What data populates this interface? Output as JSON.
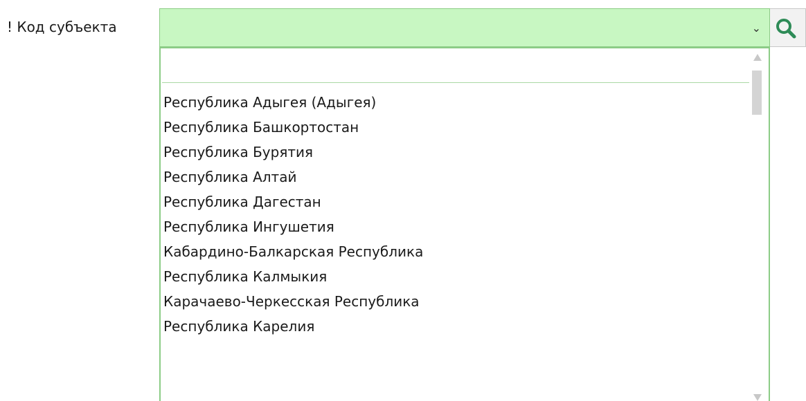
{
  "field": {
    "label": "! Код субъекта",
    "selected_value": "",
    "arrow": "chevron-down-icon"
  },
  "search_button": {
    "icon": "search-icon",
    "color": "#2e8b57"
  },
  "dropdown": {
    "filter_value": "",
    "options": [
      "Республика Адыгея (Адыгея)",
      "Республика Башкортостан",
      "Республика Бурятия",
      "Республика Алтай",
      "Республика Дагестан",
      "Республика Ингушетия",
      "Кабардино-Балкарская Республика",
      "Республика Калмыкия",
      "Карачаево-Черкесская Республика",
      "Республика Карелия"
    ]
  },
  "colors": {
    "field_bg": "#c8f7c2",
    "field_border": "#8ccc86"
  }
}
